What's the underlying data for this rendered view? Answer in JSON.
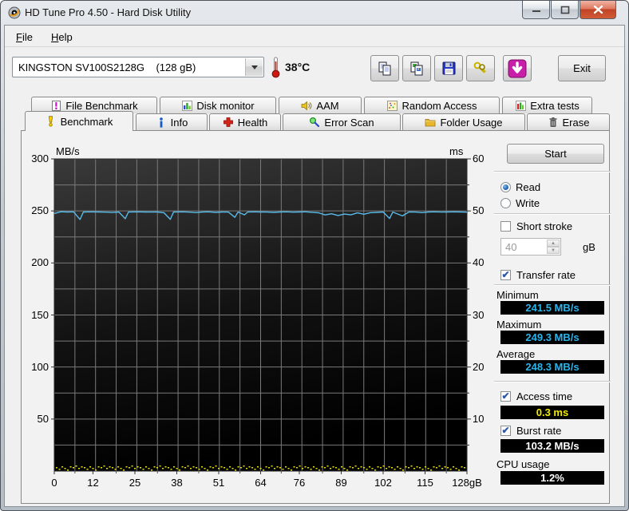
{
  "window": {
    "title": "HD Tune Pro 4.50 - Hard Disk Utility",
    "controls": {
      "minimize": "minimize",
      "maximize": "maximize",
      "close": "close"
    }
  },
  "menu": {
    "items": [
      {
        "label": "File"
      },
      {
        "label": "Help"
      }
    ]
  },
  "toolbar": {
    "device_select": {
      "value": "KINGSTON SV100S2128G    (128 gB)"
    },
    "temperature": "38°C",
    "buttons": [
      {
        "name": "copy-text-button",
        "icon": "copy-icon"
      },
      {
        "name": "copy-image-button",
        "icon": "copy-image-icon"
      },
      {
        "name": "save-button",
        "icon": "save-icon"
      },
      {
        "name": "options-button",
        "icon": "keys-icon"
      },
      {
        "name": "capture-button",
        "icon": "down-arrow-icon"
      }
    ],
    "exit_label": "Exit"
  },
  "tabs": {
    "row1": [
      {
        "label": "File Benchmark"
      },
      {
        "label": "Disk monitor"
      },
      {
        "label": "AAM"
      },
      {
        "label": "Random Access"
      },
      {
        "label": "Extra tests"
      }
    ],
    "row2": [
      {
        "label": "Benchmark",
        "active": true
      },
      {
        "label": "Info"
      },
      {
        "label": "Health"
      },
      {
        "label": "Error Scan"
      },
      {
        "label": "Folder Usage"
      },
      {
        "label": "Erase"
      }
    ]
  },
  "panel": {
    "start_label": "Start",
    "read_label": "Read",
    "write_label": "Write",
    "short_stroke_label": "Short stroke",
    "short_stroke_value": "40",
    "short_stroke_unit": "gB",
    "transfer_rate_label": "Transfer rate",
    "minimum_label": "Minimum",
    "minimum_value": "241.5 MB/s",
    "maximum_label": "Maximum",
    "maximum_value": "249.3 MB/s",
    "average_label": "Average",
    "average_value": "248.3 MB/s",
    "access_time_label": "Access time",
    "access_time_value": "0.3 ms",
    "burst_rate_label": "Burst rate",
    "burst_rate_value": "103.2 MB/s",
    "cpu_usage_label": "CPU usage",
    "cpu_usage_value": "1.2%"
  },
  "chart_data": {
    "type": "line",
    "title": "HD Tune read benchmark",
    "x_axis": {
      "range": [
        0,
        128
      ],
      "ticks": [
        0,
        12,
        25,
        38,
        51,
        64,
        76,
        89,
        102,
        115,
        128
      ],
      "tick_labels": [
        "0",
        "12",
        "25",
        "38",
        "51",
        "64",
        "76",
        "89",
        "102",
        "115",
        "128gB"
      ]
    },
    "y_left": {
      "label": "MB/s",
      "range": [
        0,
        300
      ],
      "ticks": [
        50,
        100,
        150,
        200,
        250,
        300
      ]
    },
    "y_right": {
      "label": "ms",
      "range": [
        0,
        60
      ],
      "ticks": [
        10,
        20,
        30,
        40,
        50,
        60
      ]
    },
    "grid": {
      "on": true,
      "color": "#7a7a7a",
      "minor_halfstep": true
    },
    "series": [
      {
        "name": "Transfer rate",
        "axis": "left",
        "color": "#58bae8",
        "stats": {
          "min": 241.5,
          "max": 249.3,
          "avg": 248.3,
          "unit": "MB/s"
        },
        "points": [
          [
            0,
            247.5
          ],
          [
            2,
            249.2
          ],
          [
            4,
            249.0
          ],
          [
            6,
            249.1
          ],
          [
            8,
            241.8
          ],
          [
            9,
            249.0
          ],
          [
            12,
            249.1
          ],
          [
            14,
            249.0
          ],
          [
            16,
            248.8
          ],
          [
            18,
            248.5
          ],
          [
            20,
            249.0
          ],
          [
            22,
            242.5
          ],
          [
            23,
            249.0
          ],
          [
            26,
            249.1
          ],
          [
            28,
            249.0
          ],
          [
            30,
            248.9
          ],
          [
            32,
            249.0
          ],
          [
            34,
            248.3
          ],
          [
            36,
            241.9
          ],
          [
            37,
            249.0
          ],
          [
            40,
            249.1
          ],
          [
            42,
            248.8
          ],
          [
            44,
            248.4
          ],
          [
            46,
            249.0
          ],
          [
            48,
            249.1
          ],
          [
            50,
            248.6
          ],
          [
            52,
            249.0
          ],
          [
            54,
            248.9
          ],
          [
            56,
            243.8
          ],
          [
            57,
            249.0
          ],
          [
            59,
            246.2
          ],
          [
            60,
            249.0
          ],
          [
            62,
            249.1
          ],
          [
            64,
            249.0
          ],
          [
            66,
            248.9
          ],
          [
            68,
            248.6
          ],
          [
            70,
            249.0
          ],
          [
            72,
            249.1
          ],
          [
            74,
            248.8
          ],
          [
            76,
            249.0
          ],
          [
            78,
            249.1
          ],
          [
            80,
            248.7
          ],
          [
            82,
            248.2
          ],
          [
            84,
            246.1
          ],
          [
            86,
            247.3
          ],
          [
            88,
            245.6
          ],
          [
            90,
            247.0
          ],
          [
            92,
            246.2
          ],
          [
            94,
            248.1
          ],
          [
            96,
            246.8
          ],
          [
            98,
            248.3
          ],
          [
            100,
            248.6
          ],
          [
            102,
            249.0
          ],
          [
            104,
            242.8
          ],
          [
            105,
            248.9
          ],
          [
            108,
            245.2
          ],
          [
            110,
            249.0
          ],
          [
            112,
            248.9
          ],
          [
            114,
            248.4
          ],
          [
            116,
            249.0
          ],
          [
            118,
            249.1
          ],
          [
            120,
            248.9
          ],
          [
            122,
            249.0
          ],
          [
            124,
            249.1
          ],
          [
            126,
            249.0
          ],
          [
            128,
            248.8
          ]
        ]
      },
      {
        "name": "Access time",
        "axis": "right",
        "color": "#f2ea00",
        "style": "dotted",
        "approx_value_ms": 0.3
      }
    ]
  },
  "colors": {
    "plot_bg_top": "#3a3a3a",
    "plot_bg_bottom": "#000000",
    "grid": "#7a7a7a",
    "transfer_line": "#58bae8",
    "access_dots": "#f2ea00",
    "value_cyan": "#2bb3ea",
    "value_yellow": "#f2ea00",
    "value_white": "#ffffff"
  }
}
